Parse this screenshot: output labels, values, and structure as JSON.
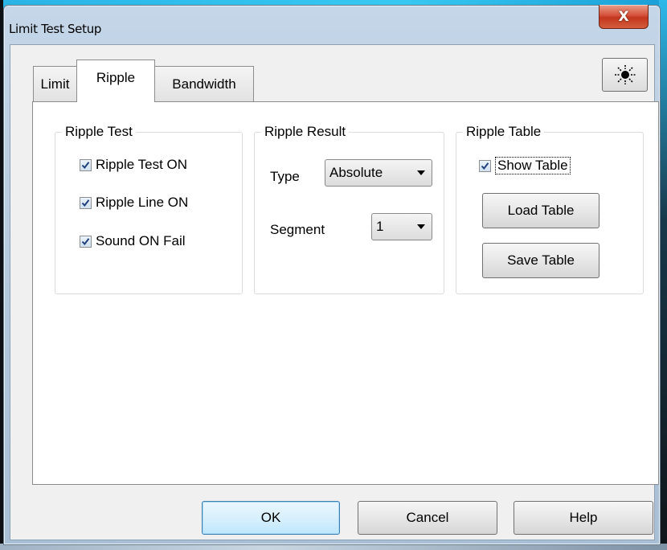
{
  "window": {
    "title": "Limit Test Setup",
    "close_label": "X"
  },
  "tabs": [
    {
      "label": "Limit",
      "active": false
    },
    {
      "label": "Ripple",
      "active": true
    },
    {
      "label": "Bandwidth",
      "active": false
    }
  ],
  "toolbar": {
    "sun_icon": "sun-icon"
  },
  "ripple_test": {
    "title": "Ripple Test",
    "options": [
      {
        "label": "Ripple Test ON",
        "checked": true
      },
      {
        "label": "Ripple Line ON",
        "checked": true
      },
      {
        "label": "Sound ON Fail",
        "checked": true
      }
    ]
  },
  "ripple_result": {
    "title": "Ripple Result",
    "type_label": "Type",
    "type_value": "Absolute",
    "segment_label": "Segment",
    "segment_value": "1"
  },
  "ripple_table": {
    "title": "Ripple Table",
    "show_table_label": "Show Table",
    "show_table_checked": true,
    "load_label": "Load Table",
    "save_label": "Save Table"
  },
  "footer": {
    "ok_label": "OK",
    "cancel_label": "Cancel",
    "help_label": "Help"
  },
  "colors": {
    "title_bar": "#b8cbe0",
    "close_button": "#c94a32",
    "default_button_border": "#3c7fb1",
    "panel_bg": "#ffffff",
    "dialog_bg": "#f0f0f0"
  }
}
